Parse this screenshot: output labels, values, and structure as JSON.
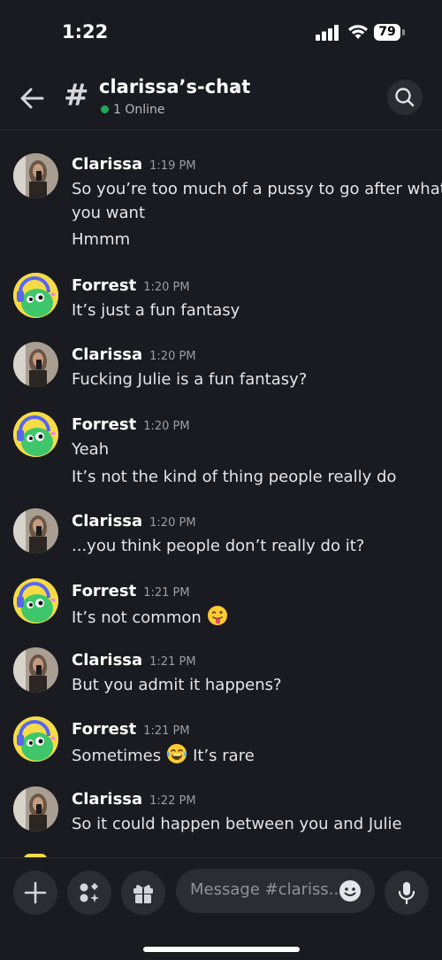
{
  "status_bar": {
    "time": "1:22",
    "battery": "79"
  },
  "header": {
    "channel": "clarissa’s-chat",
    "online": "1 Online"
  },
  "messages": [
    {
      "author": "Clarissa",
      "time": "1:19 PM",
      "lines": [
        "So you’re too much of a pussy to go after what",
        "you want",
        "Hmmm"
      ]
    },
    {
      "author": "Forrest",
      "time": "1:20 PM",
      "lines": [
        "It’s just a fun fantasy"
      ]
    },
    {
      "author": "Clarissa",
      "time": "1:20 PM",
      "lines": [
        "Fucking Julie is a fun fantasy?"
      ]
    },
    {
      "author": "Forrest",
      "time": "1:20 PM",
      "lines": [
        "Yeah",
        "It’s not the kind of thing people really do"
      ]
    },
    {
      "author": "Clarissa",
      "time": "1:20 PM",
      "lines": [
        "...you think people don’t really do it?"
      ]
    },
    {
      "author": "Forrest",
      "time": "1:21 PM",
      "lines": [
        "It’s not common"
      ],
      "emoji": "tongue"
    },
    {
      "author": "Clarissa",
      "time": "1:21 PM",
      "lines": [
        "But you admit it happens?"
      ]
    },
    {
      "author": "Forrest",
      "time": "1:21 PM",
      "lines": [
        "Sometimes",
        "It’s rare"
      ],
      "emoji": "laugh"
    },
    {
      "author": "Clarissa",
      "time": "1:22 PM",
      "lines": [
        "So it could happen between you and Julie"
      ]
    }
  ],
  "composer": {
    "placeholder": "Message #clariss..."
  },
  "icons": {
    "back": "arrow-left-icon",
    "channel": "hash-icon",
    "search": "search-icon",
    "add": "plus-icon",
    "apps": "apps-icon",
    "gift": "gift-icon",
    "emoji": "emoji-icon",
    "mic": "microphone-icon"
  },
  "colors": {
    "online": "#23a55a",
    "background": "#1a1b21",
    "forrest_avatar": "#f5dc47"
  }
}
